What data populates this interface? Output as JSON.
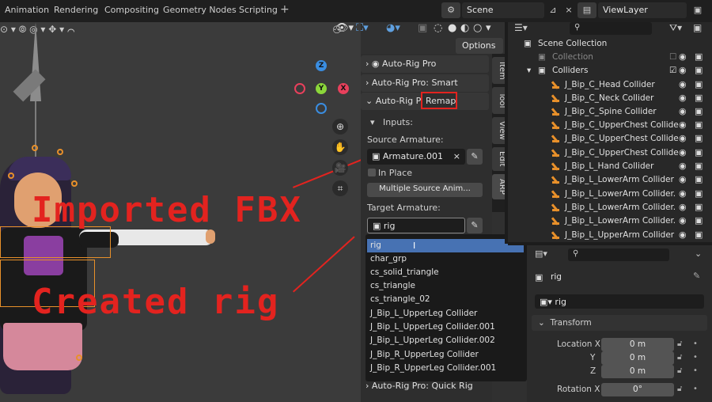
{
  "menubar": {
    "items": [
      "Animation",
      "Rendering",
      "Compositing",
      "Geometry Nodes",
      "Scripting"
    ],
    "add": "+",
    "scene": "Scene",
    "viewlayer": "ViewLayer"
  },
  "viewport": {
    "options_label": "Options"
  },
  "annotations": {
    "imported": "Imported FBX",
    "created": "Created rig"
  },
  "gizmo": {
    "z": "Z",
    "y": "Y",
    "x": "X"
  },
  "sidebar": {
    "panels": [
      "Auto-Rig Pro",
      "Auto-Rig Pro: Smart",
      "Auto-Rig Pro:",
      "Auto-Rig Pro: Quick Rig"
    ],
    "remap_label": "Remap",
    "inputs_label": "Inputs:",
    "source_armature_label": "Source Armature:",
    "source_armature_value": "Armature.001",
    "in_place_label": "In Place",
    "multiple_source_button": "Multiple Source Anim...",
    "target_armature_label": "Target Armature:",
    "target_armature_value": "rig",
    "clear_icon": "×",
    "tabs": [
      "Item",
      "Tool",
      "View",
      "Edit",
      "ARP"
    ]
  },
  "dropdown": {
    "items": [
      "rig",
      "char_grp",
      "cs_solid_triangle",
      "cs_triangle",
      "cs_triangle_02",
      "J_Bip_L_UpperLeg Collider",
      "J_Bip_L_UpperLeg Collider.001",
      "J_Bip_L_UpperLeg Collider.002",
      "J_Bip_R_UpperLeg Collider",
      "J_Bip_R_UpperLeg Collider.001"
    ],
    "selected_index": 0
  },
  "outliner": {
    "root": "Scene Collection",
    "collection": "Collection",
    "colliders": "Colliders",
    "items": [
      "J_Bip_C_Head Collider",
      "J_Bip_C_Neck Collider",
      "J_Bip_C_Spine Collider",
      "J_Bip_C_UpperChest Collide",
      "J_Bip_C_UpperChest Collide",
      "J_Bip_C_UpperChest Collide",
      "J_Bip_L_Hand Collider",
      "J_Bip_L_LowerArm Collider",
      "J_Bip_L_LowerArm Collider.",
      "J_Bip_L_LowerArm Collider.",
      "J_Bip_L_LowerArm Collider.",
      "J_Bip_L_UpperArm Collider"
    ]
  },
  "properties": {
    "object_name": "rig",
    "data_name": "rig",
    "transform_label": "Transform",
    "location_label": "Location X",
    "y_label": "Y",
    "z_label": "Z",
    "location_x": "0 m",
    "location_y": "0 m",
    "location_z": "0 m",
    "rotation_label": "Rotation X",
    "rotation_x": "0°"
  }
}
